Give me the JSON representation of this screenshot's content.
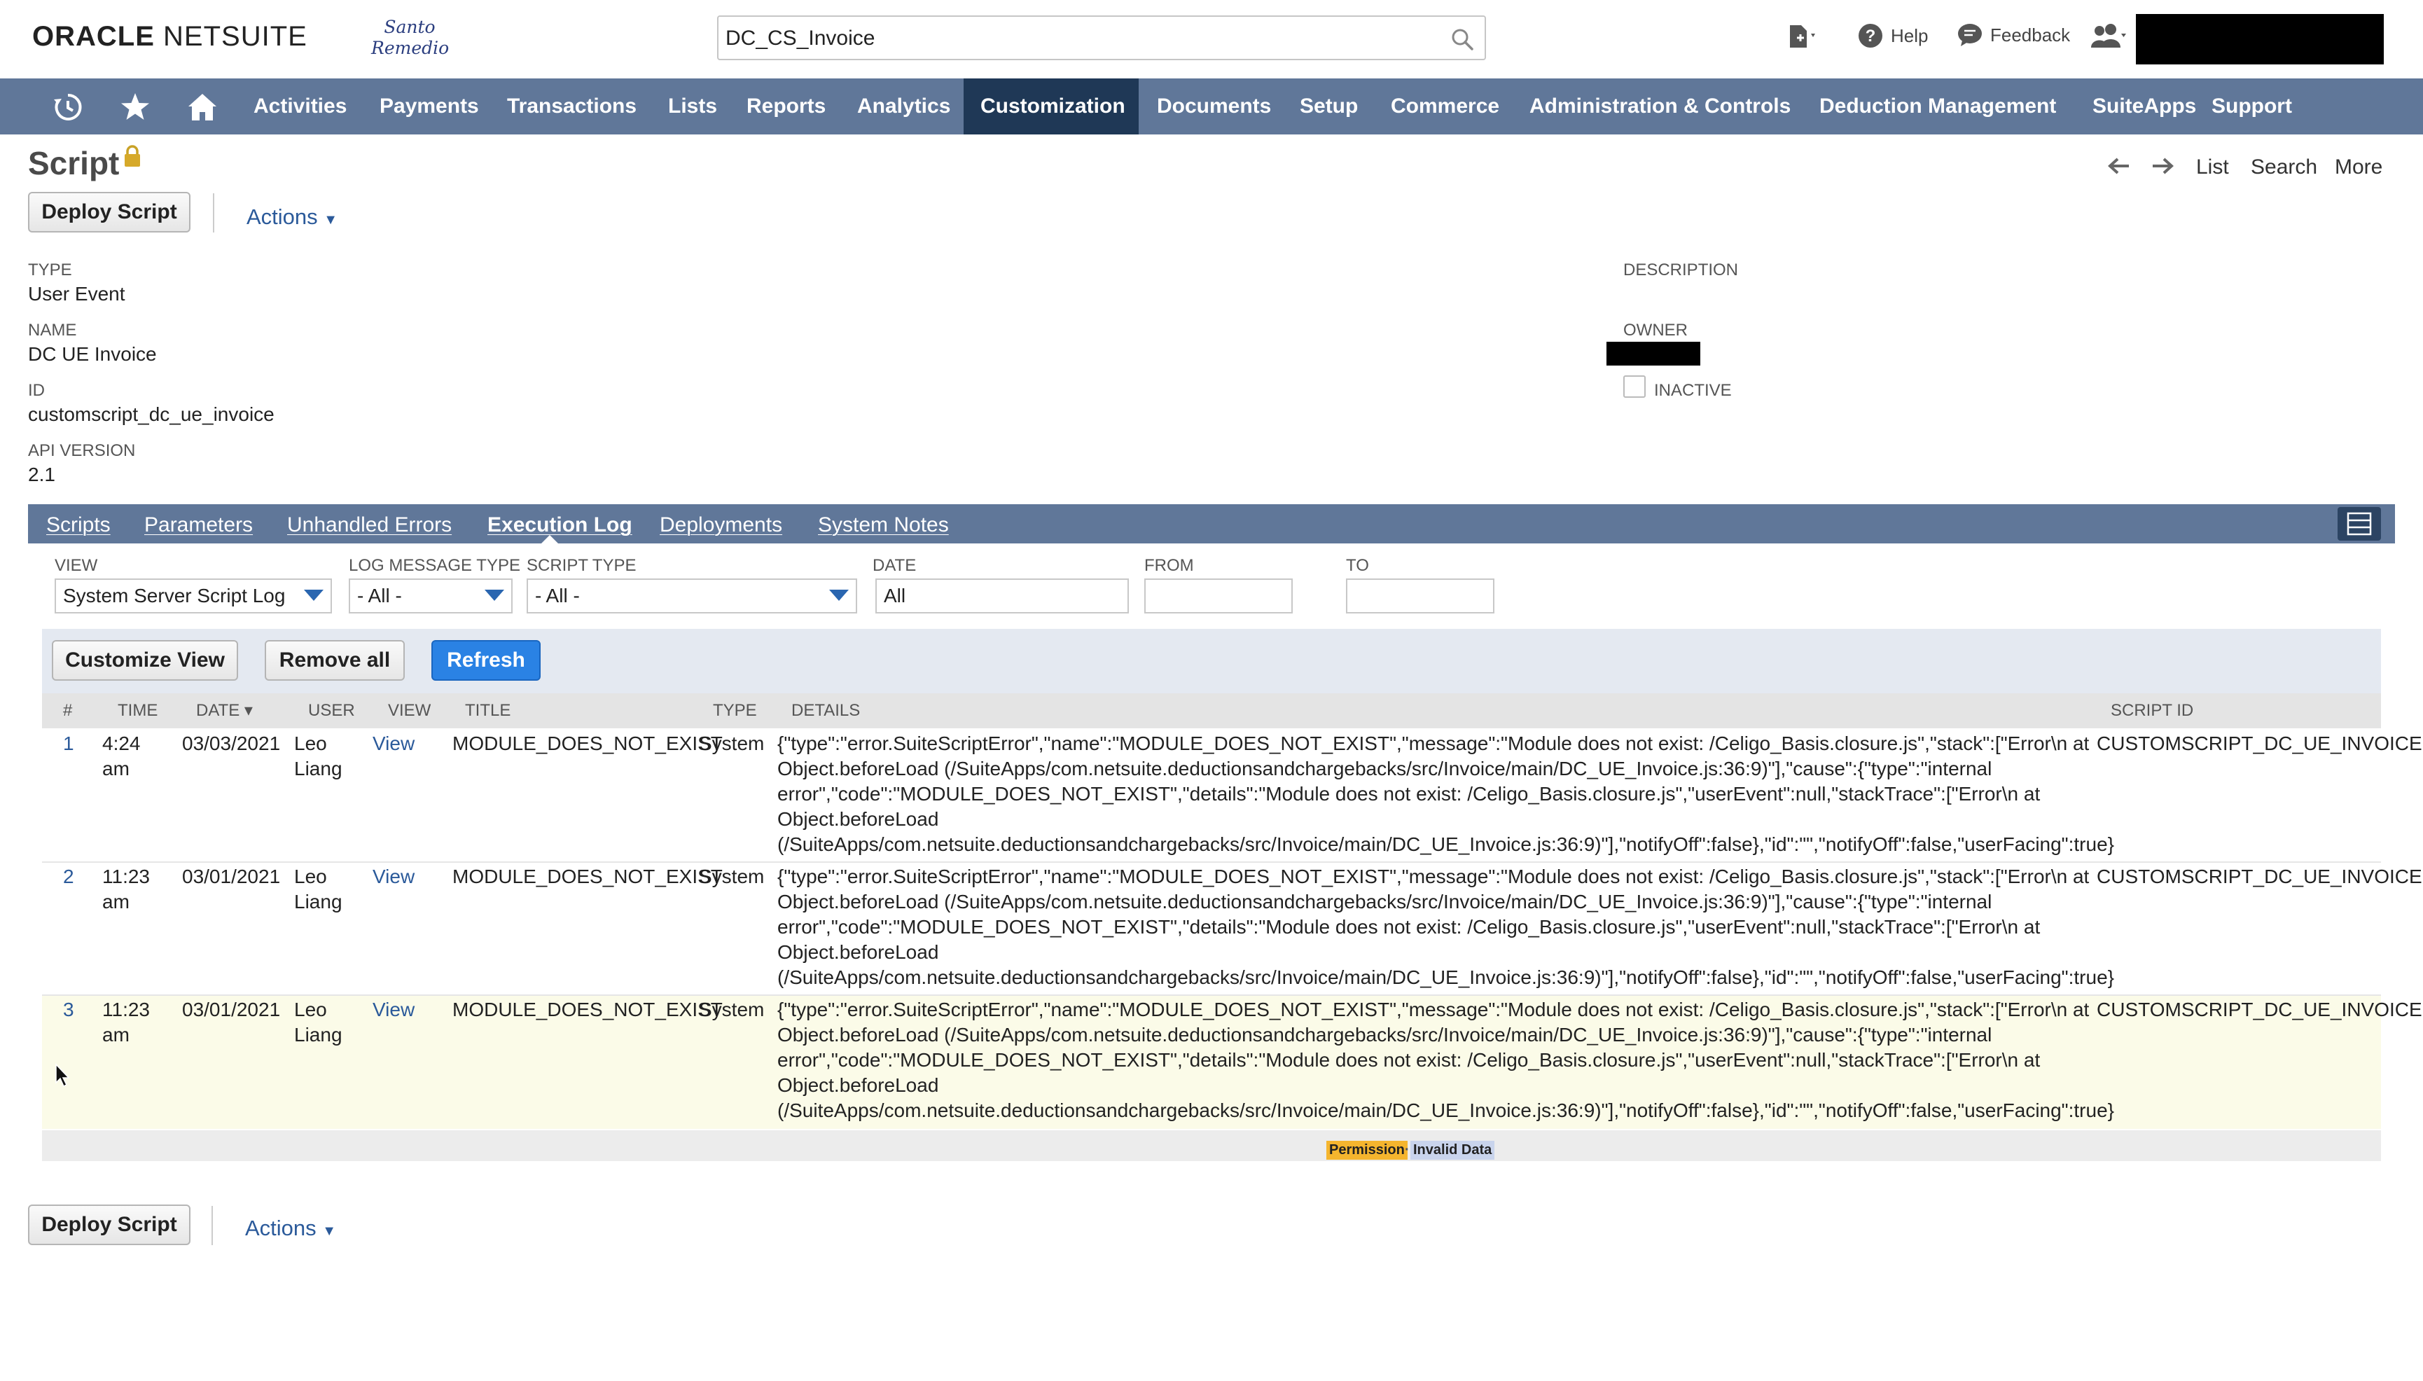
{
  "header": {
    "logo_bold": "ORACLE",
    "logo_rest": "NETSUITE",
    "brand_line1": "Santo",
    "brand_line2": "Remedio",
    "search_value": "DC_CS_Invoice",
    "help_label": "Help",
    "feedback_label": "Feedback"
  },
  "nav": {
    "items": [
      "Activities",
      "Payments",
      "Transactions",
      "Lists",
      "Reports",
      "Analytics",
      "Customization",
      "Documents",
      "Setup",
      "Commerce",
      "Administration & Controls",
      "Deduction Management",
      "SuiteApps",
      "Support"
    ],
    "active": "Customization"
  },
  "page": {
    "title": "Script",
    "deploy_label": "Deploy Script",
    "actions_label": "Actions",
    "list_link": "List",
    "search_link": "Search",
    "more_link": "More"
  },
  "fields": {
    "type_label": "Type",
    "type_value": "User Event",
    "name_label": "Name",
    "name_value": "DC UE Invoice",
    "id_label": "ID",
    "id_value": "customscript_dc_ue_invoice",
    "api_label": "API Version",
    "api_value": "2.1",
    "description_label": "Description",
    "owner_label": "Owner",
    "inactive_label": "Inactive"
  },
  "subtabs": {
    "items": [
      "Scripts",
      "Parameters",
      "Unhandled Errors",
      "Execution Log",
      "Deployments",
      "System Notes"
    ],
    "active": "Execution Log"
  },
  "filters": {
    "view_label": "View",
    "view_value": "System Server Script Log",
    "log_type_label": "Log Message Type",
    "log_type_value": "- All -",
    "script_type_label": "Script Type",
    "script_type_value": "- All -",
    "date_label": "Date",
    "date_value": "All",
    "from_label": "From",
    "from_value": "",
    "to_label": "To",
    "to_value": ""
  },
  "list": {
    "customize_label": "Customize View",
    "remove_all_label": "Remove all",
    "refresh_label": "Refresh",
    "columns": [
      "#",
      "Time",
      "Date ▾",
      "User",
      "View",
      "Title",
      "Type",
      "Details",
      "Script ID"
    ],
    "rows": [
      {
        "num": "1",
        "time_l1": "4:24",
        "time_l2": "am",
        "date": "03/03/2021",
        "user_l1": "Leo",
        "user_l2": "Liang",
        "view": "View",
        "title": "MODULE_DOES_NOT_EXIST",
        "type": "System",
        "details": [
          "{\"type\":\"error.SuiteScriptError\",\"name\":\"MODULE_DOES_NOT_EXIST\",\"message\":\"Module does not exist: /Celigo_Basis.closure.js\",\"stack\":[\"Error\\n at",
          "Object.beforeLoad (/SuiteApps/com.netsuite.deductionsandchargebacks/src/Invoice/main/DC_UE_Invoice.js:36:9)\"],\"cause\":{\"type\":\"internal",
          "error\",\"code\":\"MODULE_DOES_NOT_EXIST\",\"details\":\"Module does not exist: /Celigo_Basis.closure.js\",\"userEvent\":null,\"stackTrace\":[\"Error\\n at",
          "Object.beforeLoad",
          "(/SuiteApps/com.netsuite.deductionsandchargebacks/src/Invoice/main/DC_UE_Invoice.js:36:9)\"],\"notifyOff\":false},\"id\":\"\",\"notifyOff\":false,\"userFacing\":true}"
        ],
        "script_id": "CUSTOMSCRIPT_DC_UE_INVOICE"
      },
      {
        "num": "2",
        "time_l1": "11:23",
        "time_l2": "am",
        "date": "03/01/2021",
        "user_l1": "Leo",
        "user_l2": "Liang",
        "view": "View",
        "title": "MODULE_DOES_NOT_EXIST",
        "type": "System",
        "details": [
          "{\"type\":\"error.SuiteScriptError\",\"name\":\"MODULE_DOES_NOT_EXIST\",\"message\":\"Module does not exist: /Celigo_Basis.closure.js\",\"stack\":[\"Error\\n at",
          "Object.beforeLoad (/SuiteApps/com.netsuite.deductionsandchargebacks/src/Invoice/main/DC_UE_Invoice.js:36:9)\"],\"cause\":{\"type\":\"internal",
          "error\",\"code\":\"MODULE_DOES_NOT_EXIST\",\"details\":\"Module does not exist: /Celigo_Basis.closure.js\",\"userEvent\":null,\"stackTrace\":[\"Error\\n at",
          "Object.beforeLoad",
          "(/SuiteApps/com.netsuite.deductionsandchargebacks/src/Invoice/main/DC_UE_Invoice.js:36:9)\"],\"notifyOff\":false},\"id\":\"\",\"notifyOff\":false,\"userFacing\":true}"
        ],
        "script_id": "CUSTOMSCRIPT_DC_UE_INVOICE"
      },
      {
        "num": "3",
        "time_l1": "11:23",
        "time_l2": "am",
        "date": "03/01/2021",
        "user_l1": "Leo",
        "user_l2": "Liang",
        "view": "View",
        "title": "MODULE_DOES_NOT_EXIST",
        "type": "System",
        "details": [
          "{\"type\":\"error.SuiteScriptError\",\"name\":\"MODULE_DOES_NOT_EXIST\",\"message\":\"Module does not exist: /Celigo_Basis.closure.js\",\"stack\":[\"Error\\n at",
          "Object.beforeLoad (/SuiteApps/com.netsuite.deductionsandchargebacks/src/Invoice/main/DC_UE_Invoice.js:36:9)\"],\"cause\":{\"type\":\"internal",
          "error\",\"code\":\"MODULE_DOES_NOT_EXIST\",\"details\":\"Module does not exist: /Celigo_Basis.closure.js\",\"userEvent\":null,\"stackTrace\":[\"Error\\n at",
          "Object.beforeLoad",
          "(/SuiteApps/com.netsuite.deductionsandchargebacks/src/Invoice/main/DC_UE_Invoice.js:36:9)\"],\"notifyOff\":false},\"id\":\"\",\"notifyOff\":false,\"userFacing\":true}"
        ],
        "script_id": "CUSTOMSCRIPT_DC_UE_INVOICE"
      }
    ],
    "badge_permission": "Permission",
    "badge_separator": "·",
    "badge_invalid": "Invalid Data"
  },
  "colors": {
    "nav_bg": "#607799",
    "nav_active": "#1f3856",
    "link": "#2b5a9a",
    "refresh_blue": "#2a82e4",
    "badge_orange": "#f5b52e",
    "badge_blue": "#c9d4ec",
    "highlight_row": "#fbfbe8"
  },
  "icons": [
    "search-icon",
    "doc-add-icon",
    "help-icon",
    "feedback-icon",
    "people-icon",
    "recent-icon",
    "star-icon",
    "home-icon",
    "lock-icon",
    "arrow-left-icon",
    "arrow-right-icon",
    "layout-icon",
    "dropdown-icon",
    "cursor-icon"
  ]
}
